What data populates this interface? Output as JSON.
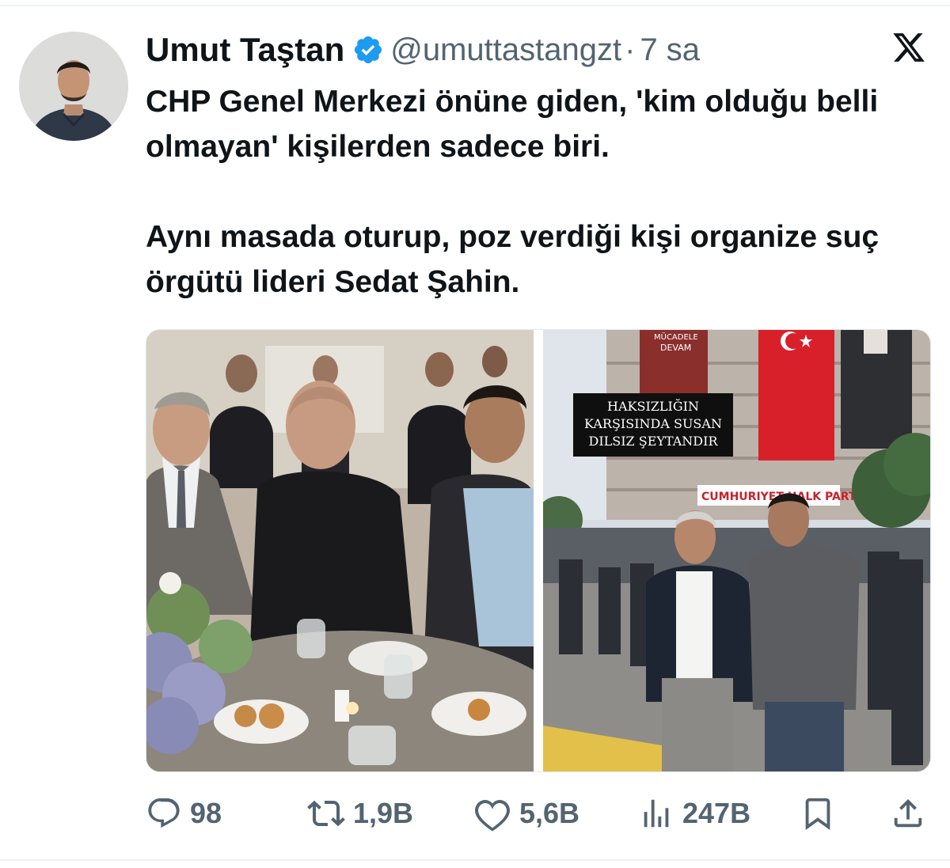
{
  "tweet": {
    "author": {
      "display_name": "Umut Taştan",
      "handle": "@umuttastangzt",
      "separator": "·",
      "time": "7 sa",
      "verified": true
    },
    "text_paragraphs": [
      "CHP Genel Merkezi önüne giden, 'kim olduğu belli olmayan' kişilerden sadece biri.",
      "Aynı masada oturup, poz verdiği kişi organize suç örgütü lideri Sedat Şahin."
    ],
    "media": {
      "left_photo": {
        "desc": "group-at-dinner-table"
      },
      "right_photo": {
        "caption_lines": [
          "HAKSIZLIĞIN",
          "KARŞISINDA SUSAN",
          "DILSIZ ŞEYTANDIR"
        ],
        "sign_text": "CUMHURIYET HALK PARTI",
        "banner_text": [
          "MÜCADELE",
          "DEVAM"
        ]
      }
    },
    "actions": {
      "reply_count": "98",
      "retweet_count": "1,9B",
      "like_count": "5,6B",
      "views_count": "247B"
    }
  },
  "icons": {
    "verified": "verified-badge-icon",
    "platform": "x-logo-icon",
    "reply": "reply-icon",
    "retweet": "retweet-icon",
    "like": "heart-icon",
    "views": "views-chart-icon",
    "bookmark": "bookmark-icon",
    "share": "share-icon"
  },
  "colors": {
    "verified_blue": "#1d9bf0",
    "secondary_text": "#536471",
    "primary_text": "#0f1419"
  }
}
